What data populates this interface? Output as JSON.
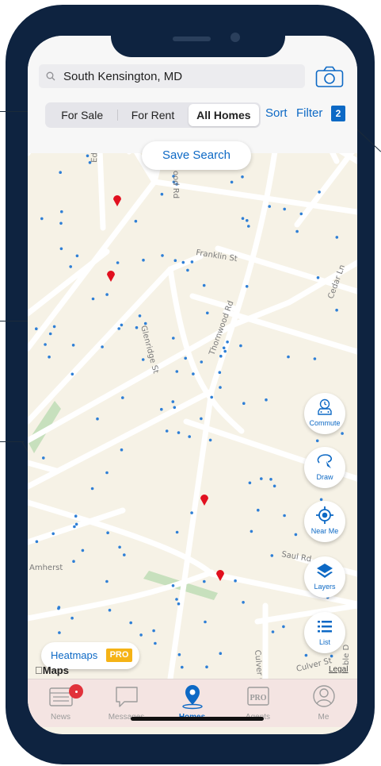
{
  "search": {
    "value": "South Kensington, MD"
  },
  "segments": [
    {
      "label": "For Sale"
    },
    {
      "label": "For Rent"
    },
    {
      "label": "All Homes",
      "active": true
    }
  ],
  "sort_label": "Sort",
  "filter_label": "Filter",
  "filter_count": "2",
  "save_search_label": "Save Search",
  "streets": {
    "franklin": "Franklin St",
    "thornwood": "Thornwood Rd",
    "glenridge": "Glenridge St",
    "cedar": "Cedar Ln",
    "edgefield": "Edgefiel",
    "wood_rd": "ood Rd",
    "saul": "Saul Rd",
    "amherst": "Amherst",
    "culver_ct": "Culver Ct",
    "culver_st": "Culver St",
    "ble": "ble D"
  },
  "map_controls": [
    {
      "label": "Commute",
      "icon": "car-clock-icon"
    },
    {
      "label": "Draw",
      "icon": "draw-lasso-icon"
    },
    {
      "label": "Near Me",
      "icon": "crosshair-icon"
    },
    {
      "label": "Layers",
      "icon": "layers-icon"
    },
    {
      "label": "List",
      "icon": "list-icon"
    }
  ],
  "heatmaps": {
    "label": "Heatmaps",
    "badge": "PRO"
  },
  "maps_attribution": "Maps",
  "legal_label": "Legal",
  "tabs": [
    {
      "label": "News",
      "icon": "news-icon"
    },
    {
      "label": "Messages",
      "icon": "chat-bubble-icon"
    },
    {
      "label": "Homes",
      "icon": "location-pin-icon",
      "active": true
    },
    {
      "label": "Agents",
      "icon": "pro-badge-icon"
    },
    {
      "label": "Me",
      "icon": "person-icon"
    }
  ],
  "colors": {
    "accent": "#0d69c5",
    "frame": "#0e2340",
    "marker": "#e1101f",
    "pro_badge": "#f5b316",
    "map_bg": "#f6f2e6"
  }
}
